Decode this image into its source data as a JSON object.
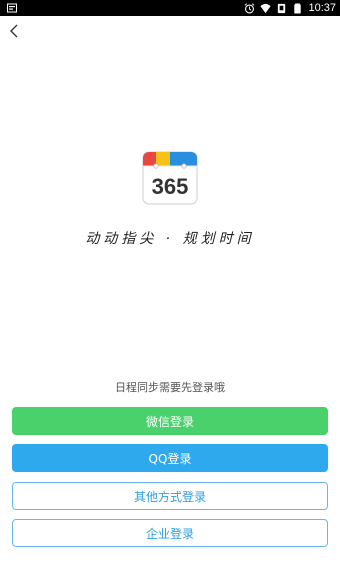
{
  "status_bar": {
    "time": "10:37"
  },
  "logo": {
    "number": "365"
  },
  "slogan": "动动指尖 · 规划时间",
  "hint": "日程同步需要先登录哦",
  "buttons": {
    "wechat": "微信登录",
    "qq": "QQ登录",
    "other": "其他方式登录",
    "company": "企业登录"
  },
  "colors": {
    "wechat": "#4bd16b",
    "qq": "#2fa9ee",
    "outline": "#68b7ec",
    "logo_red": "#e8483f",
    "logo_yellow": "#f6c21a",
    "logo_blue": "#2a8ee0"
  }
}
